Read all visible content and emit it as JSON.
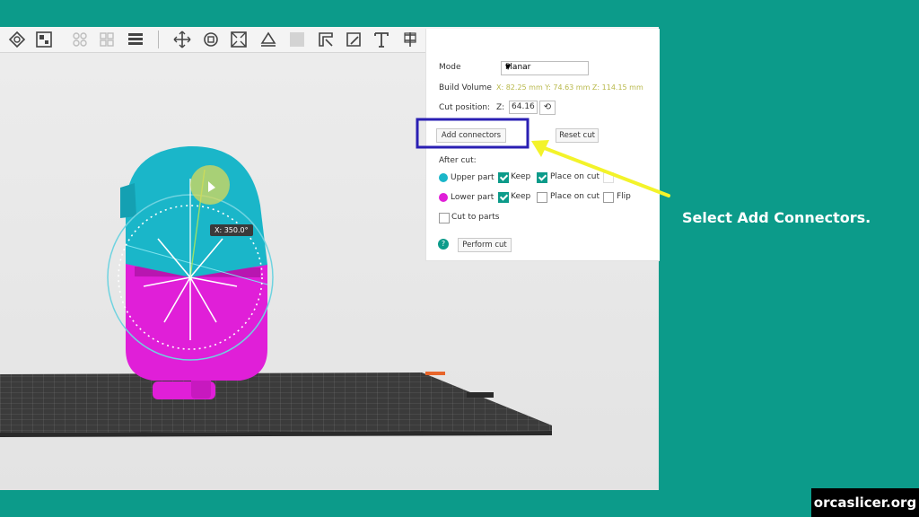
{
  "cut_panel": {
    "mode_label": "Mode",
    "mode_value": "Planar",
    "build_volume_label": "Build Volume",
    "build_volume_value": "X: 82.25 mm  Y: 74.63 mm  Z: 114.15 mm",
    "cut_position_label": "Cut position:",
    "cut_axis_label": "Z:",
    "cut_position_value": "64.16",
    "add_connectors_label": "Add connectors",
    "reset_cut_label": "Reset cut",
    "after_cut_label": "After cut:",
    "upper_part_label": "Upper part",
    "lower_part_label": "Lower part",
    "keep_label": "Keep",
    "place_on_cut_label": "Place on cut",
    "flip_label": "Flip",
    "cut_to_parts_label": "Cut to parts",
    "perform_cut_label": "Perform cut",
    "upper_keep": true,
    "upper_place_on_cut": true,
    "lower_keep": true,
    "lower_place_on_cut": false,
    "lower_flip": false,
    "cut_to_parts": false
  },
  "viewport": {
    "rotation_readout": "X: 350.0°"
  },
  "annotation": {
    "caption": "Select Add Connectors.",
    "highlight_color": "#2a1fb3",
    "arrow_color": "#f3f32a"
  },
  "branding": {
    "site": "orcaslicer.org"
  },
  "colors": {
    "background": "#0c9b8a",
    "upper_part": "#1ab6c9",
    "lower_part": "#e01fd8"
  }
}
